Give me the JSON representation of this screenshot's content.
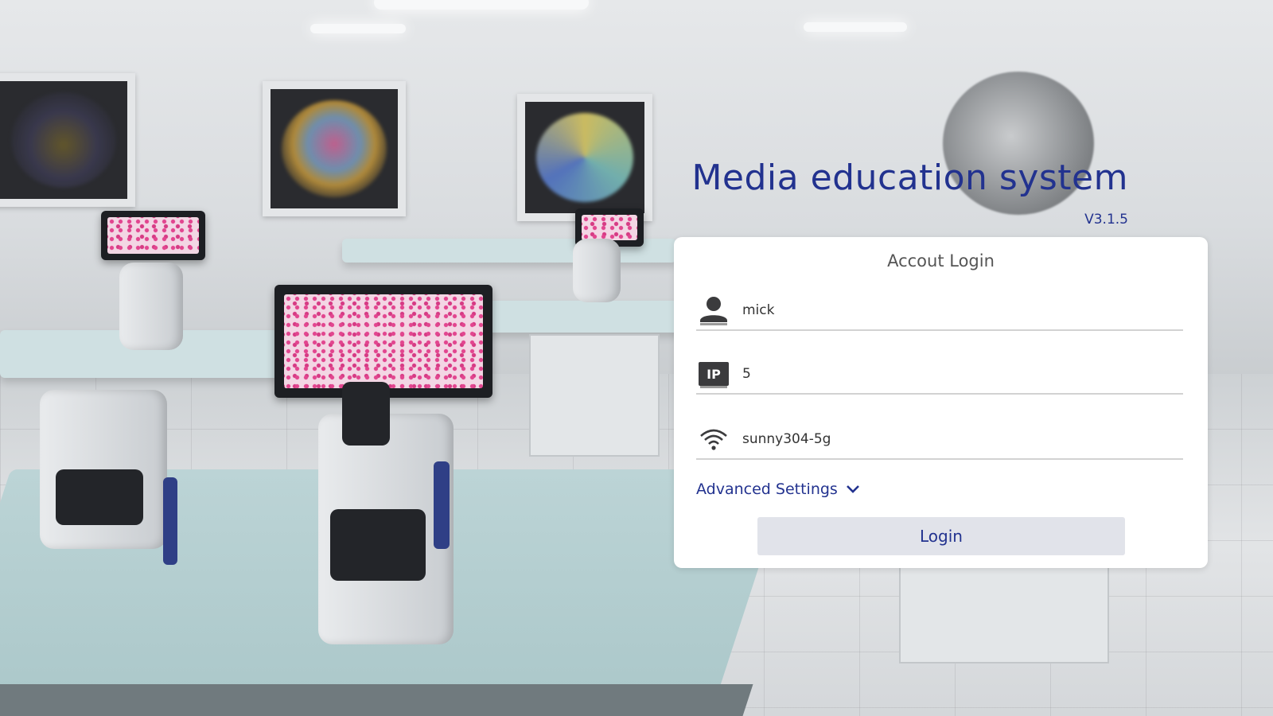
{
  "app": {
    "title": "Media education system",
    "version": "V3.1.5"
  },
  "login": {
    "card_title": "Accout Login",
    "username": {
      "value": "mick",
      "icon": "user-icon"
    },
    "ip": {
      "value": "5",
      "icon": "ip-badge-icon",
      "badge_text": "IP"
    },
    "wifi": {
      "value": "sunny304-5g",
      "icon": "wifi-icon"
    },
    "advanced_settings_label": "Advanced Settings",
    "login_button_label": "Login"
  },
  "colors": {
    "accent": "#22328f",
    "card_background": "#ffffff",
    "button_background": "#e1e3ea"
  }
}
